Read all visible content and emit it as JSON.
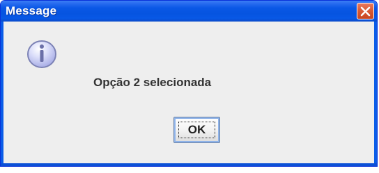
{
  "dialog": {
    "title": "Message",
    "message": "Opção 2 selecionada",
    "ok_label": "OK",
    "icon": "information-icon",
    "close_icon": "close-icon"
  },
  "colors": {
    "titlebar": "#0654e0",
    "close_button": "#d95b36",
    "content_bg": "#eeeeee",
    "text": "#333333",
    "icon_fill": "#c9cdf2",
    "icon_border": "#7c82b5"
  }
}
